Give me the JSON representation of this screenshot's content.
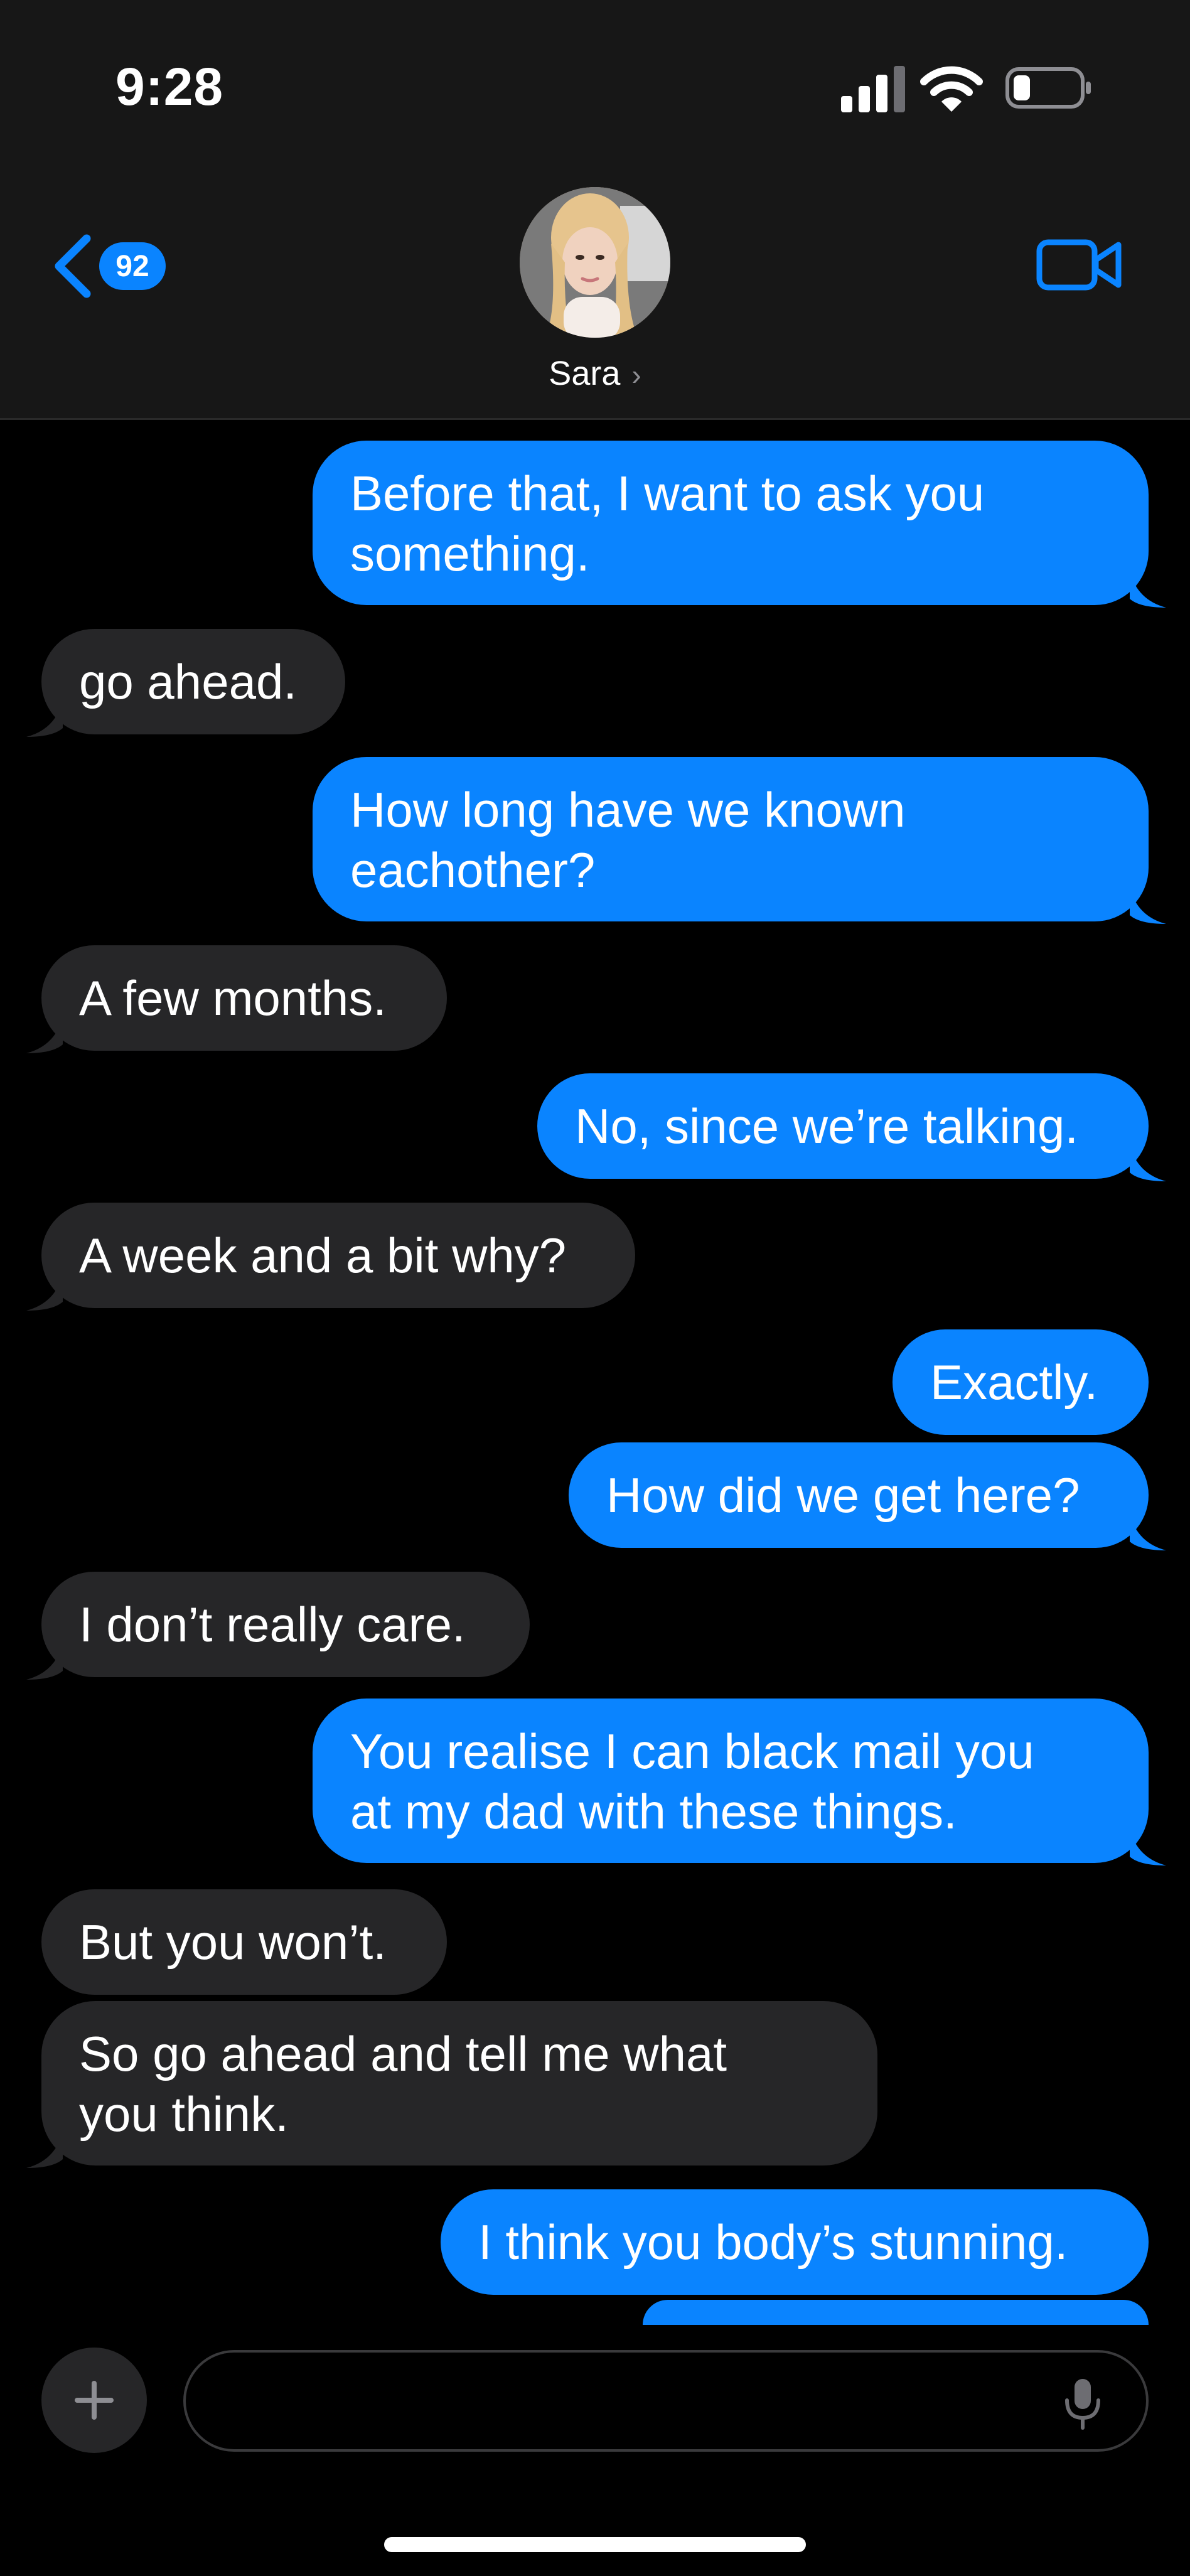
{
  "status_bar": {
    "time": "9:28",
    "signal_icon": "cellular-signal-icon",
    "wifi_icon": "wifi-icon",
    "battery_icon": "battery-low-icon"
  },
  "header": {
    "back_badge": "92",
    "contact_name": "Sara",
    "back_icon": "chevron-left-icon",
    "video_icon": "facetime-video-icon"
  },
  "messages": [
    {
      "side": "out",
      "lines": [
        "Before that, I want to ask you",
        "something."
      ]
    },
    {
      "side": "in",
      "lines": [
        "go ahead."
      ]
    },
    {
      "side": "out",
      "lines": [
        "How long have we known",
        "eachother?"
      ]
    },
    {
      "side": "in",
      "lines": [
        "A few months."
      ]
    },
    {
      "side": "out",
      "lines": [
        "No, since we’re talking."
      ]
    },
    {
      "side": "in",
      "lines": [
        "A week and a bit why?"
      ]
    },
    {
      "side": "out",
      "lines": [
        "Exactly."
      ]
    },
    {
      "side": "out",
      "lines": [
        "How did we get here?"
      ]
    },
    {
      "side": "in",
      "lines": [
        "I don’t really care."
      ]
    },
    {
      "side": "out",
      "lines": [
        "You realise I can black mail you",
        "at my dad with these things."
      ]
    },
    {
      "side": "in",
      "lines": [
        "But you won’t."
      ]
    },
    {
      "side": "in",
      "lines": [
        "So go ahead and tell me what",
        "you think."
      ]
    },
    {
      "side": "out",
      "lines": [
        "I think you body’s stunning."
      ]
    }
  ],
  "composer": {
    "plus_icon": "plus-icon",
    "mic_icon": "microphone-icon",
    "placeholder": ""
  },
  "colors": {
    "outgoing_bubble": "#0a84ff",
    "incoming_bubble": "#262628",
    "accent": "#0a84ff",
    "background": "#000000",
    "header_background": "#171717"
  }
}
